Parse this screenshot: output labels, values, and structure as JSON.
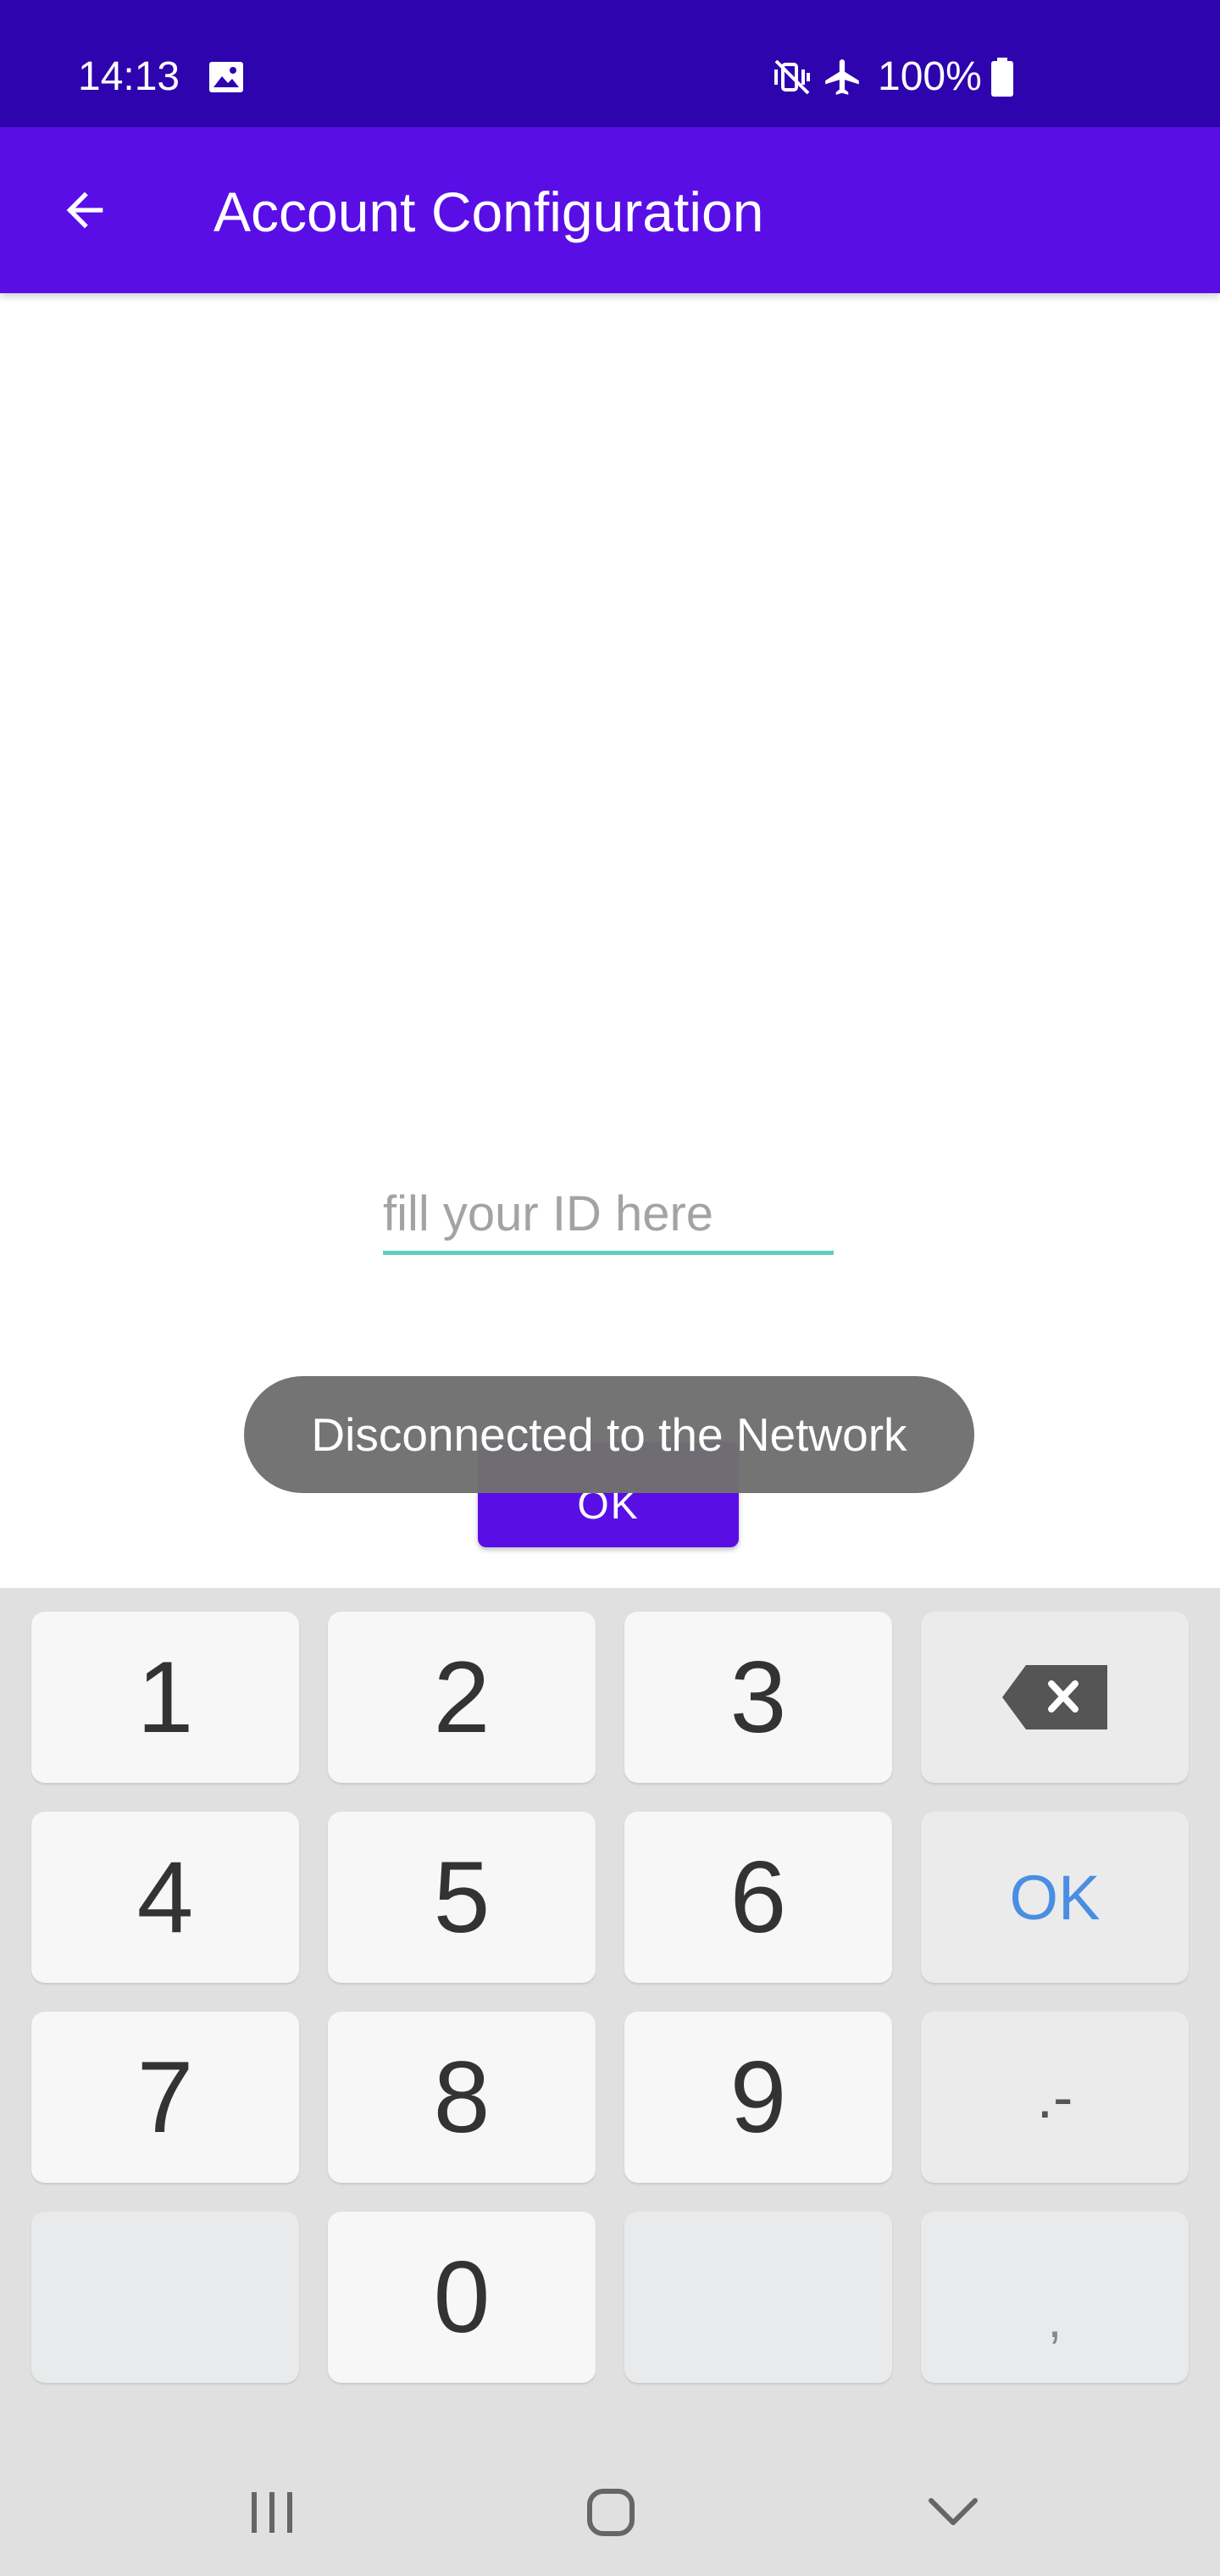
{
  "status_bar": {
    "time": "14:13",
    "battery": "100%",
    "icons": [
      "image-icon",
      "mute-vibrate-icon",
      "airplane-icon",
      "battery-icon"
    ]
  },
  "app_bar": {
    "title": "Account Configuration",
    "back_icon": "arrow-left-icon",
    "background": "#5a0ee6"
  },
  "form": {
    "id_placeholder": "fill your ID here",
    "id_value": "",
    "ok_label": "OK"
  },
  "toast": {
    "message": "Disconnected to the Network"
  },
  "keyboard": {
    "keys": {
      "k1": "1",
      "k2": "2",
      "k3": "3",
      "k4": "4",
      "k5": "5",
      "k6": "6",
      "k7": "7",
      "k8": "8",
      "k9": "9",
      "k0": "0",
      "ok": "OK",
      "dot_minus": ".-",
      "comma": ","
    },
    "backspace_icon": "backspace-icon",
    "accent": "#4a8ee3"
  },
  "nav_bar": {
    "buttons": [
      "recent-apps-icon",
      "home-icon",
      "hide-keyboard-icon"
    ]
  }
}
